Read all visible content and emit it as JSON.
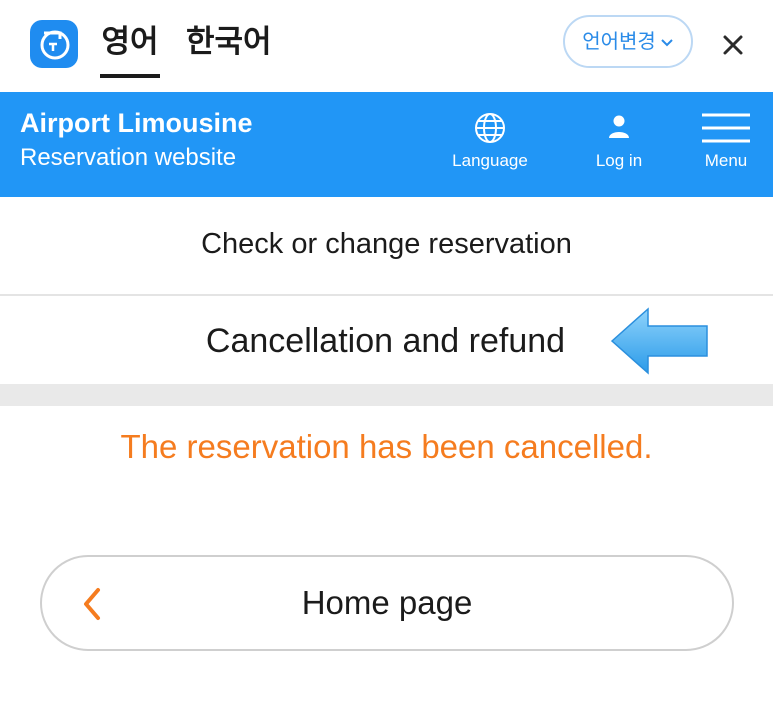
{
  "colors": {
    "header_blue": "#2196f6",
    "accent_orange": "#f57c1f",
    "link_blue": "#2a8be8",
    "arrow_blue": "#3aa9f2"
  },
  "translate_bar": {
    "app_icon": "translate-app-icon",
    "tabs": [
      {
        "label": "영어",
        "selected": true
      },
      {
        "label": "한국어",
        "selected": false
      }
    ],
    "change_language_label": "언어변경",
    "change_language_icon": "chevron-down-icon",
    "close_icon": "close-icon"
  },
  "header": {
    "title": "Airport Limousine",
    "subtitle": "Reservation website",
    "items": [
      {
        "label": "Language",
        "icon": "globe-icon"
      },
      {
        "label": "Log in",
        "icon": "user-icon"
      },
      {
        "label": "Menu",
        "icon": "hamburger-icon"
      }
    ]
  },
  "menu": {
    "items": [
      {
        "label": "Check or change reservation"
      },
      {
        "label": "Cancellation and refund",
        "pointer_icon": "arrow-left-icon"
      }
    ]
  },
  "message": "The reservation has been cancelled.",
  "home_button": {
    "label": "Home page",
    "icon": "chevron-left-icon"
  }
}
